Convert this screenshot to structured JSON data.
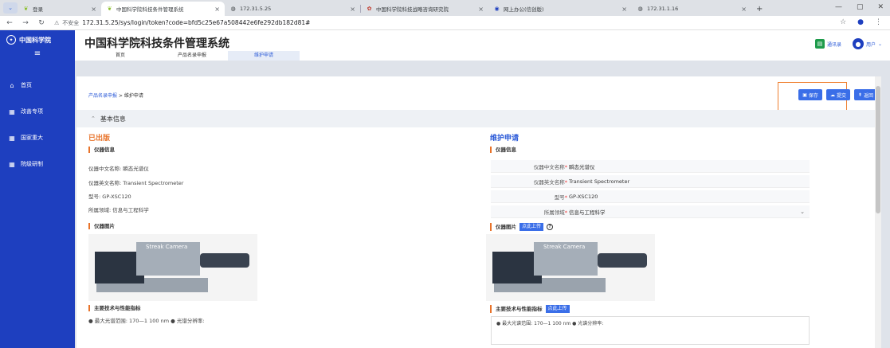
{
  "browser": {
    "tabs": [
      {
        "title": "登录",
        "icon": "leaf",
        "active": false
      },
      {
        "title": "中国科学院科技条件管理系统",
        "icon": "leaf",
        "active": true
      },
      {
        "title": "172.31.5.25",
        "icon": "globe",
        "active": false
      },
      {
        "title": "中国科学院科技战略咨询研究院",
        "icon": "seal",
        "active": false
      },
      {
        "title": "网上办公(信创版)",
        "icon": "record",
        "active": false
      },
      {
        "title": "172.31.1.16",
        "icon": "globe",
        "active": false
      }
    ],
    "new_tab": "+",
    "security_label": "不安全",
    "url": "172.31.5.25/sys/login/token?code=bfd5c25e67a508442e6fe292db182d81#"
  },
  "app": {
    "logo_text": "中国科学院",
    "title": "中国科学院科技条件管理系统",
    "tabs": [
      "首页",
      "产品名录申报",
      "维护申请"
    ],
    "active_tab": 2,
    "address_book": "通讯录",
    "user_label": "用户"
  },
  "sidebar": {
    "items": [
      {
        "label": "首页",
        "icon": "home"
      },
      {
        "label": "改善专项",
        "icon": "grid"
      },
      {
        "label": "国家重大",
        "icon": "grid"
      },
      {
        "label": "院级研制",
        "icon": "grid"
      }
    ]
  },
  "main": {
    "breadcrumb_parent": "产品名录申报",
    "breadcrumb_sep": " > ",
    "breadcrumb_current": "维护申请",
    "actions": {
      "save": "保存",
      "submit": "提交",
      "back": "返回"
    },
    "section_title": "基本信息",
    "left": {
      "title": "已出版",
      "info_heading": "仪器信息",
      "cn_name_label": "仪器中文名称:",
      "cn_name": "瞬态光谱仪",
      "en_name_label": "仪器英文名称:",
      "en_name": "Transient Spectrometer",
      "model_label": "型号:",
      "model": "GP-XSC120",
      "field_label": "所属领域:",
      "field": "信息与工程科学",
      "image_heading": "仪器图片",
      "image_label": "Streak Camera",
      "spec_heading": "主要技术与性能指标",
      "spec_text": "● 最大光谱范围: 170—1 100 nm ● 光谱分辨率:"
    },
    "right": {
      "title": "维护申请",
      "info_heading": "仪器信息",
      "cn_name_label": "仪器中文名称",
      "cn_name": "瞬态光谱仪",
      "en_name_label": "仪器英文名称",
      "en_name": "Transient Spectrometer",
      "model_label": "型号",
      "model": "GP-XSC120",
      "field_label": "所属领域",
      "field": "信息与工程科学",
      "image_heading": "仪器图片",
      "upload_label": "点此上传",
      "image_label": "Streak Camera",
      "spec_heading": "主要技术与性能指标",
      "spec_upload_label": "点此上传",
      "spec_text": "● 最大光谱范围: 170—1 100 nm ● 光谱分辨率:"
    }
  },
  "colors": {
    "brand": "#1e3fbf",
    "accent": "#3a6ee8",
    "orange": "#e8732a",
    "highlight": "#f08030"
  }
}
